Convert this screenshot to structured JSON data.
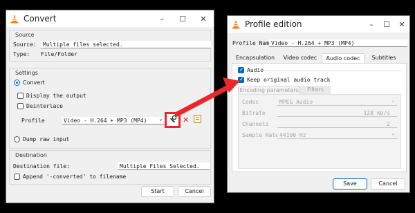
{
  "convert": {
    "title": "Convert",
    "source": {
      "group_title": "Source",
      "source_label": "Source:",
      "source_value": "Multiple files selected.",
      "type_label": "Type:",
      "type_value": "File/Folder"
    },
    "settings": {
      "group_title": "Settings",
      "convert_label": "Convert",
      "display_output_label": "Display the output",
      "deinterlace_label": "Deinterlace",
      "profile_label": "Profile",
      "profile_value": "Video - H.264 + MP3 (MP4)",
      "dump_raw_label": "Dump raw input"
    },
    "destination": {
      "group_title": "Destination",
      "file_label": "Destination file:",
      "file_value": "Multiple Files Selected.",
      "append_label": "Append '-converted' to filename"
    },
    "start_label": "Start",
    "cancel_label": "Cancel"
  },
  "profile": {
    "title": "Profile edition",
    "name_label": "Profile Name",
    "name_value": "Video - H.264 + MP3 (MP4)",
    "tabs": [
      "Encapsulation",
      "Video codec",
      "Audio codec",
      "Subtitles"
    ],
    "audio_label": "Audio",
    "keep_label": "Keep original audio track",
    "subtabs": [
      "Encoding parameters",
      "Filters"
    ],
    "codec_label": "Codec",
    "codec_value": "MPEG Audio",
    "bitrate_label": "Bitrate",
    "bitrate_value": "128 kb/s",
    "channels_label": "Channels",
    "channels_value": "2",
    "samplerate_label": "Sample Rate",
    "samplerate_value": "44100 Hz",
    "save_label": "Save",
    "cancel_label": "Cancel"
  },
  "icons": {
    "minimize": "–",
    "maximize": "☐",
    "close": "✕",
    "chevron": "⌄",
    "wrench": "🔧",
    "delete": "✕",
    "spin_up": "▲",
    "spin_down": "▼"
  },
  "colors": {
    "accent": "#0067c0",
    "highlight": "#e8282b"
  }
}
